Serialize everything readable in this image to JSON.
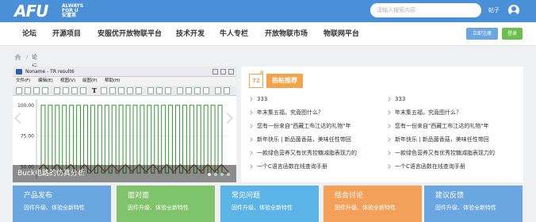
{
  "header": {
    "logo_text": "AFU",
    "logo_sub_en": "ALWAYS FOR U",
    "logo_sub_cn": "安富莱",
    "search_placeholder": "请输入搜索内容",
    "search_button": "帖子"
  },
  "nav": {
    "items": [
      "论坛",
      "开源项目",
      "安服优开放物联平台",
      "技术开发",
      "牛人专栏",
      "开放物联市场",
      "物联网平台"
    ],
    "register_button": "立即注册",
    "login_button": "登录"
  },
  "breadcrumb": {
    "current": "论坛"
  },
  "slideshow": {
    "window_title": "Noname - TR result6",
    "menu": [
      "文件(F)",
      "编辑(E)",
      "视图(V)",
      "绘图(P)",
      "帮助(H)"
    ],
    "caption": "Buck电路的仿真分析",
    "dot_count": 4,
    "active_dot": 0
  },
  "chart_data": {
    "type": "line",
    "title": "",
    "xlabel": "",
    "ylabel": "",
    "yticks": [
      "100.00",
      "75.00",
      "50.00"
    ],
    "ylim": [
      40,
      105
    ],
    "series": [
      {
        "color": "#2e9a2e",
        "shape": "square-wave",
        "high": 100,
        "low": 45,
        "pulses": 26
      },
      {
        "color": "#b03a2e",
        "shape": "triangle-wave",
        "peak": 52,
        "trough": 46,
        "cycles": 14
      }
    ]
  },
  "hot": {
    "badge": "72",
    "badge_top": "H",
    "title": "热帖推荐",
    "left": [
      "333",
      "年末集五福，究竟图什么？",
      "您有一份来自\"西藏工布江达的礼物\"年",
      "新年快乐 | 新品菌香菇，美味任性带回",
      "一款绿色营养又有优秀控糖减脂表现力的",
      "一个C语言函数在线查询手册"
    ],
    "right": [
      "333",
      "年末集五福，究竟图什么？",
      "您有一份来自\"西藏工布江达的礼物\"年",
      "新年快乐 | 新品菌香菇，美味任性带回",
      "一款绿色营养又有优秀控糖减脂表现力的",
      "一个C语言函数在线查询手册"
    ]
  },
  "tiles": [
    {
      "title": "产品发布",
      "sub": "固件升级、体验全新特性",
      "color": "#6aa6e0"
    },
    {
      "title": "面对面",
      "sub": "固件升级、体验全新特性",
      "color": "#7fc36a"
    },
    {
      "title": "常见问题",
      "sub": "固件升级、体验全新特性",
      "color": "#5cb3e6"
    },
    {
      "title": "结合讨论",
      "sub": "固件升级、体验全新特性",
      "color": "#f3a05a"
    },
    {
      "title": "建议反馈",
      "sub": "固件升级、体验全新特性",
      "color": "#6aa6e0"
    }
  ]
}
